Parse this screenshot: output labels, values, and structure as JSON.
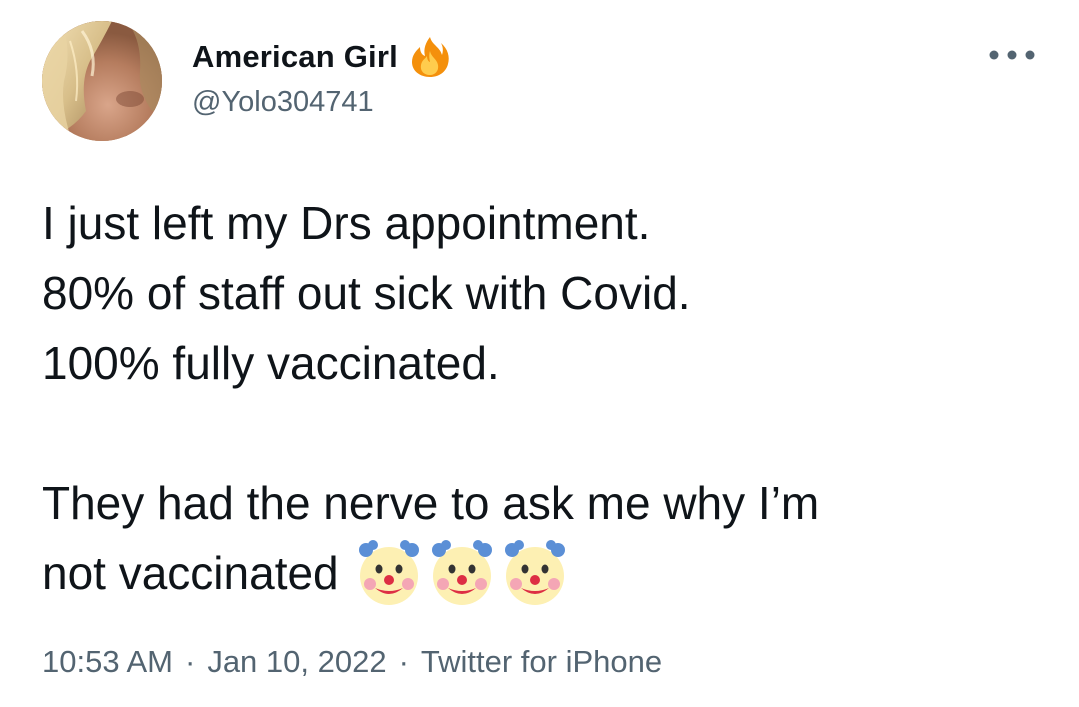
{
  "author": {
    "display_name": "American Girl",
    "handle": "@Yolo304741",
    "avatar_icon": "avatar-photo",
    "badge_icon": "fire-emoji"
  },
  "tweet": {
    "lines": [
      "I just left my Drs appointment.",
      "80% of staff out sick with Covid.",
      "100% fully vaccinated.",
      "They had the nerve to ask me why I’m",
      "not vaccinated"
    ],
    "trailing_emoji": [
      "clown-face-emoji",
      "clown-face-emoji",
      "clown-face-emoji"
    ]
  },
  "meta": {
    "time": "10:53 AM",
    "date": "Jan 10, 2022",
    "separator": "·",
    "source": "Twitter for iPhone"
  },
  "menu": {
    "more_icon": "more-horizontal-icon"
  },
  "colors": {
    "text_primary": "#0f1419",
    "text_secondary": "#536471",
    "background": "#ffffff"
  }
}
